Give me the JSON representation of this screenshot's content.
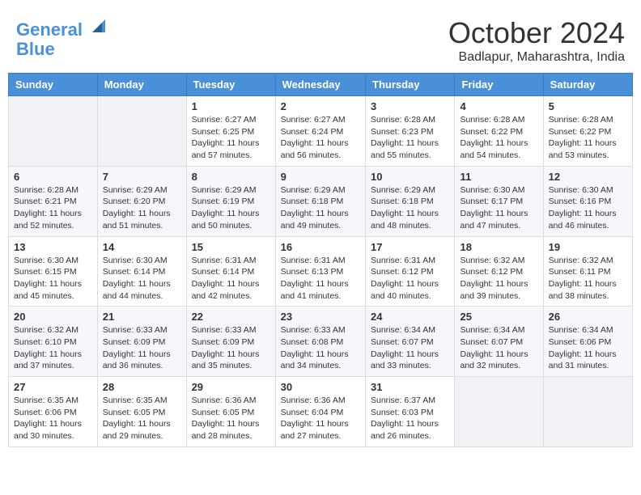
{
  "header": {
    "logo_line1": "General",
    "logo_line2": "Blue",
    "month": "October 2024",
    "location": "Badlapur, Maharashtra, India"
  },
  "weekdays": [
    "Sunday",
    "Monday",
    "Tuesday",
    "Wednesday",
    "Thursday",
    "Friday",
    "Saturday"
  ],
  "weeks": [
    [
      {
        "day": "",
        "sunrise": "",
        "sunset": "",
        "daylight": ""
      },
      {
        "day": "",
        "sunrise": "",
        "sunset": "",
        "daylight": ""
      },
      {
        "day": "1",
        "sunrise": "Sunrise: 6:27 AM",
        "sunset": "Sunset: 6:25 PM",
        "daylight": "Daylight: 11 hours and 57 minutes."
      },
      {
        "day": "2",
        "sunrise": "Sunrise: 6:27 AM",
        "sunset": "Sunset: 6:24 PM",
        "daylight": "Daylight: 11 hours and 56 minutes."
      },
      {
        "day": "3",
        "sunrise": "Sunrise: 6:28 AM",
        "sunset": "Sunset: 6:23 PM",
        "daylight": "Daylight: 11 hours and 55 minutes."
      },
      {
        "day": "4",
        "sunrise": "Sunrise: 6:28 AM",
        "sunset": "Sunset: 6:22 PM",
        "daylight": "Daylight: 11 hours and 54 minutes."
      },
      {
        "day": "5",
        "sunrise": "Sunrise: 6:28 AM",
        "sunset": "Sunset: 6:22 PM",
        "daylight": "Daylight: 11 hours and 53 minutes."
      }
    ],
    [
      {
        "day": "6",
        "sunrise": "Sunrise: 6:28 AM",
        "sunset": "Sunset: 6:21 PM",
        "daylight": "Daylight: 11 hours and 52 minutes."
      },
      {
        "day": "7",
        "sunrise": "Sunrise: 6:29 AM",
        "sunset": "Sunset: 6:20 PM",
        "daylight": "Daylight: 11 hours and 51 minutes."
      },
      {
        "day": "8",
        "sunrise": "Sunrise: 6:29 AM",
        "sunset": "Sunset: 6:19 PM",
        "daylight": "Daylight: 11 hours and 50 minutes."
      },
      {
        "day": "9",
        "sunrise": "Sunrise: 6:29 AM",
        "sunset": "Sunset: 6:18 PM",
        "daylight": "Daylight: 11 hours and 49 minutes."
      },
      {
        "day": "10",
        "sunrise": "Sunrise: 6:29 AM",
        "sunset": "Sunset: 6:18 PM",
        "daylight": "Daylight: 11 hours and 48 minutes."
      },
      {
        "day": "11",
        "sunrise": "Sunrise: 6:30 AM",
        "sunset": "Sunset: 6:17 PM",
        "daylight": "Daylight: 11 hours and 47 minutes."
      },
      {
        "day": "12",
        "sunrise": "Sunrise: 6:30 AM",
        "sunset": "Sunset: 6:16 PM",
        "daylight": "Daylight: 11 hours and 46 minutes."
      }
    ],
    [
      {
        "day": "13",
        "sunrise": "Sunrise: 6:30 AM",
        "sunset": "Sunset: 6:15 PM",
        "daylight": "Daylight: 11 hours and 45 minutes."
      },
      {
        "day": "14",
        "sunrise": "Sunrise: 6:30 AM",
        "sunset": "Sunset: 6:14 PM",
        "daylight": "Daylight: 11 hours and 44 minutes."
      },
      {
        "day": "15",
        "sunrise": "Sunrise: 6:31 AM",
        "sunset": "Sunset: 6:14 PM",
        "daylight": "Daylight: 11 hours and 42 minutes."
      },
      {
        "day": "16",
        "sunrise": "Sunrise: 6:31 AM",
        "sunset": "Sunset: 6:13 PM",
        "daylight": "Daylight: 11 hours and 41 minutes."
      },
      {
        "day": "17",
        "sunrise": "Sunrise: 6:31 AM",
        "sunset": "Sunset: 6:12 PM",
        "daylight": "Daylight: 11 hours and 40 minutes."
      },
      {
        "day": "18",
        "sunrise": "Sunrise: 6:32 AM",
        "sunset": "Sunset: 6:12 PM",
        "daylight": "Daylight: 11 hours and 39 minutes."
      },
      {
        "day": "19",
        "sunrise": "Sunrise: 6:32 AM",
        "sunset": "Sunset: 6:11 PM",
        "daylight": "Daylight: 11 hours and 38 minutes."
      }
    ],
    [
      {
        "day": "20",
        "sunrise": "Sunrise: 6:32 AM",
        "sunset": "Sunset: 6:10 PM",
        "daylight": "Daylight: 11 hours and 37 minutes."
      },
      {
        "day": "21",
        "sunrise": "Sunrise: 6:33 AM",
        "sunset": "Sunset: 6:09 PM",
        "daylight": "Daylight: 11 hours and 36 minutes."
      },
      {
        "day": "22",
        "sunrise": "Sunrise: 6:33 AM",
        "sunset": "Sunset: 6:09 PM",
        "daylight": "Daylight: 11 hours and 35 minutes."
      },
      {
        "day": "23",
        "sunrise": "Sunrise: 6:33 AM",
        "sunset": "Sunset: 6:08 PM",
        "daylight": "Daylight: 11 hours and 34 minutes."
      },
      {
        "day": "24",
        "sunrise": "Sunrise: 6:34 AM",
        "sunset": "Sunset: 6:07 PM",
        "daylight": "Daylight: 11 hours and 33 minutes."
      },
      {
        "day": "25",
        "sunrise": "Sunrise: 6:34 AM",
        "sunset": "Sunset: 6:07 PM",
        "daylight": "Daylight: 11 hours and 32 minutes."
      },
      {
        "day": "26",
        "sunrise": "Sunrise: 6:34 AM",
        "sunset": "Sunset: 6:06 PM",
        "daylight": "Daylight: 11 hours and 31 minutes."
      }
    ],
    [
      {
        "day": "27",
        "sunrise": "Sunrise: 6:35 AM",
        "sunset": "Sunset: 6:06 PM",
        "daylight": "Daylight: 11 hours and 30 minutes."
      },
      {
        "day": "28",
        "sunrise": "Sunrise: 6:35 AM",
        "sunset": "Sunset: 6:05 PM",
        "daylight": "Daylight: 11 hours and 29 minutes."
      },
      {
        "day": "29",
        "sunrise": "Sunrise: 6:36 AM",
        "sunset": "Sunset: 6:05 PM",
        "daylight": "Daylight: 11 hours and 28 minutes."
      },
      {
        "day": "30",
        "sunrise": "Sunrise: 6:36 AM",
        "sunset": "Sunset: 6:04 PM",
        "daylight": "Daylight: 11 hours and 27 minutes."
      },
      {
        "day": "31",
        "sunrise": "Sunrise: 6:37 AM",
        "sunset": "Sunset: 6:03 PM",
        "daylight": "Daylight: 11 hours and 26 minutes."
      },
      {
        "day": "",
        "sunrise": "",
        "sunset": "",
        "daylight": ""
      },
      {
        "day": "",
        "sunrise": "",
        "sunset": "",
        "daylight": ""
      }
    ]
  ]
}
